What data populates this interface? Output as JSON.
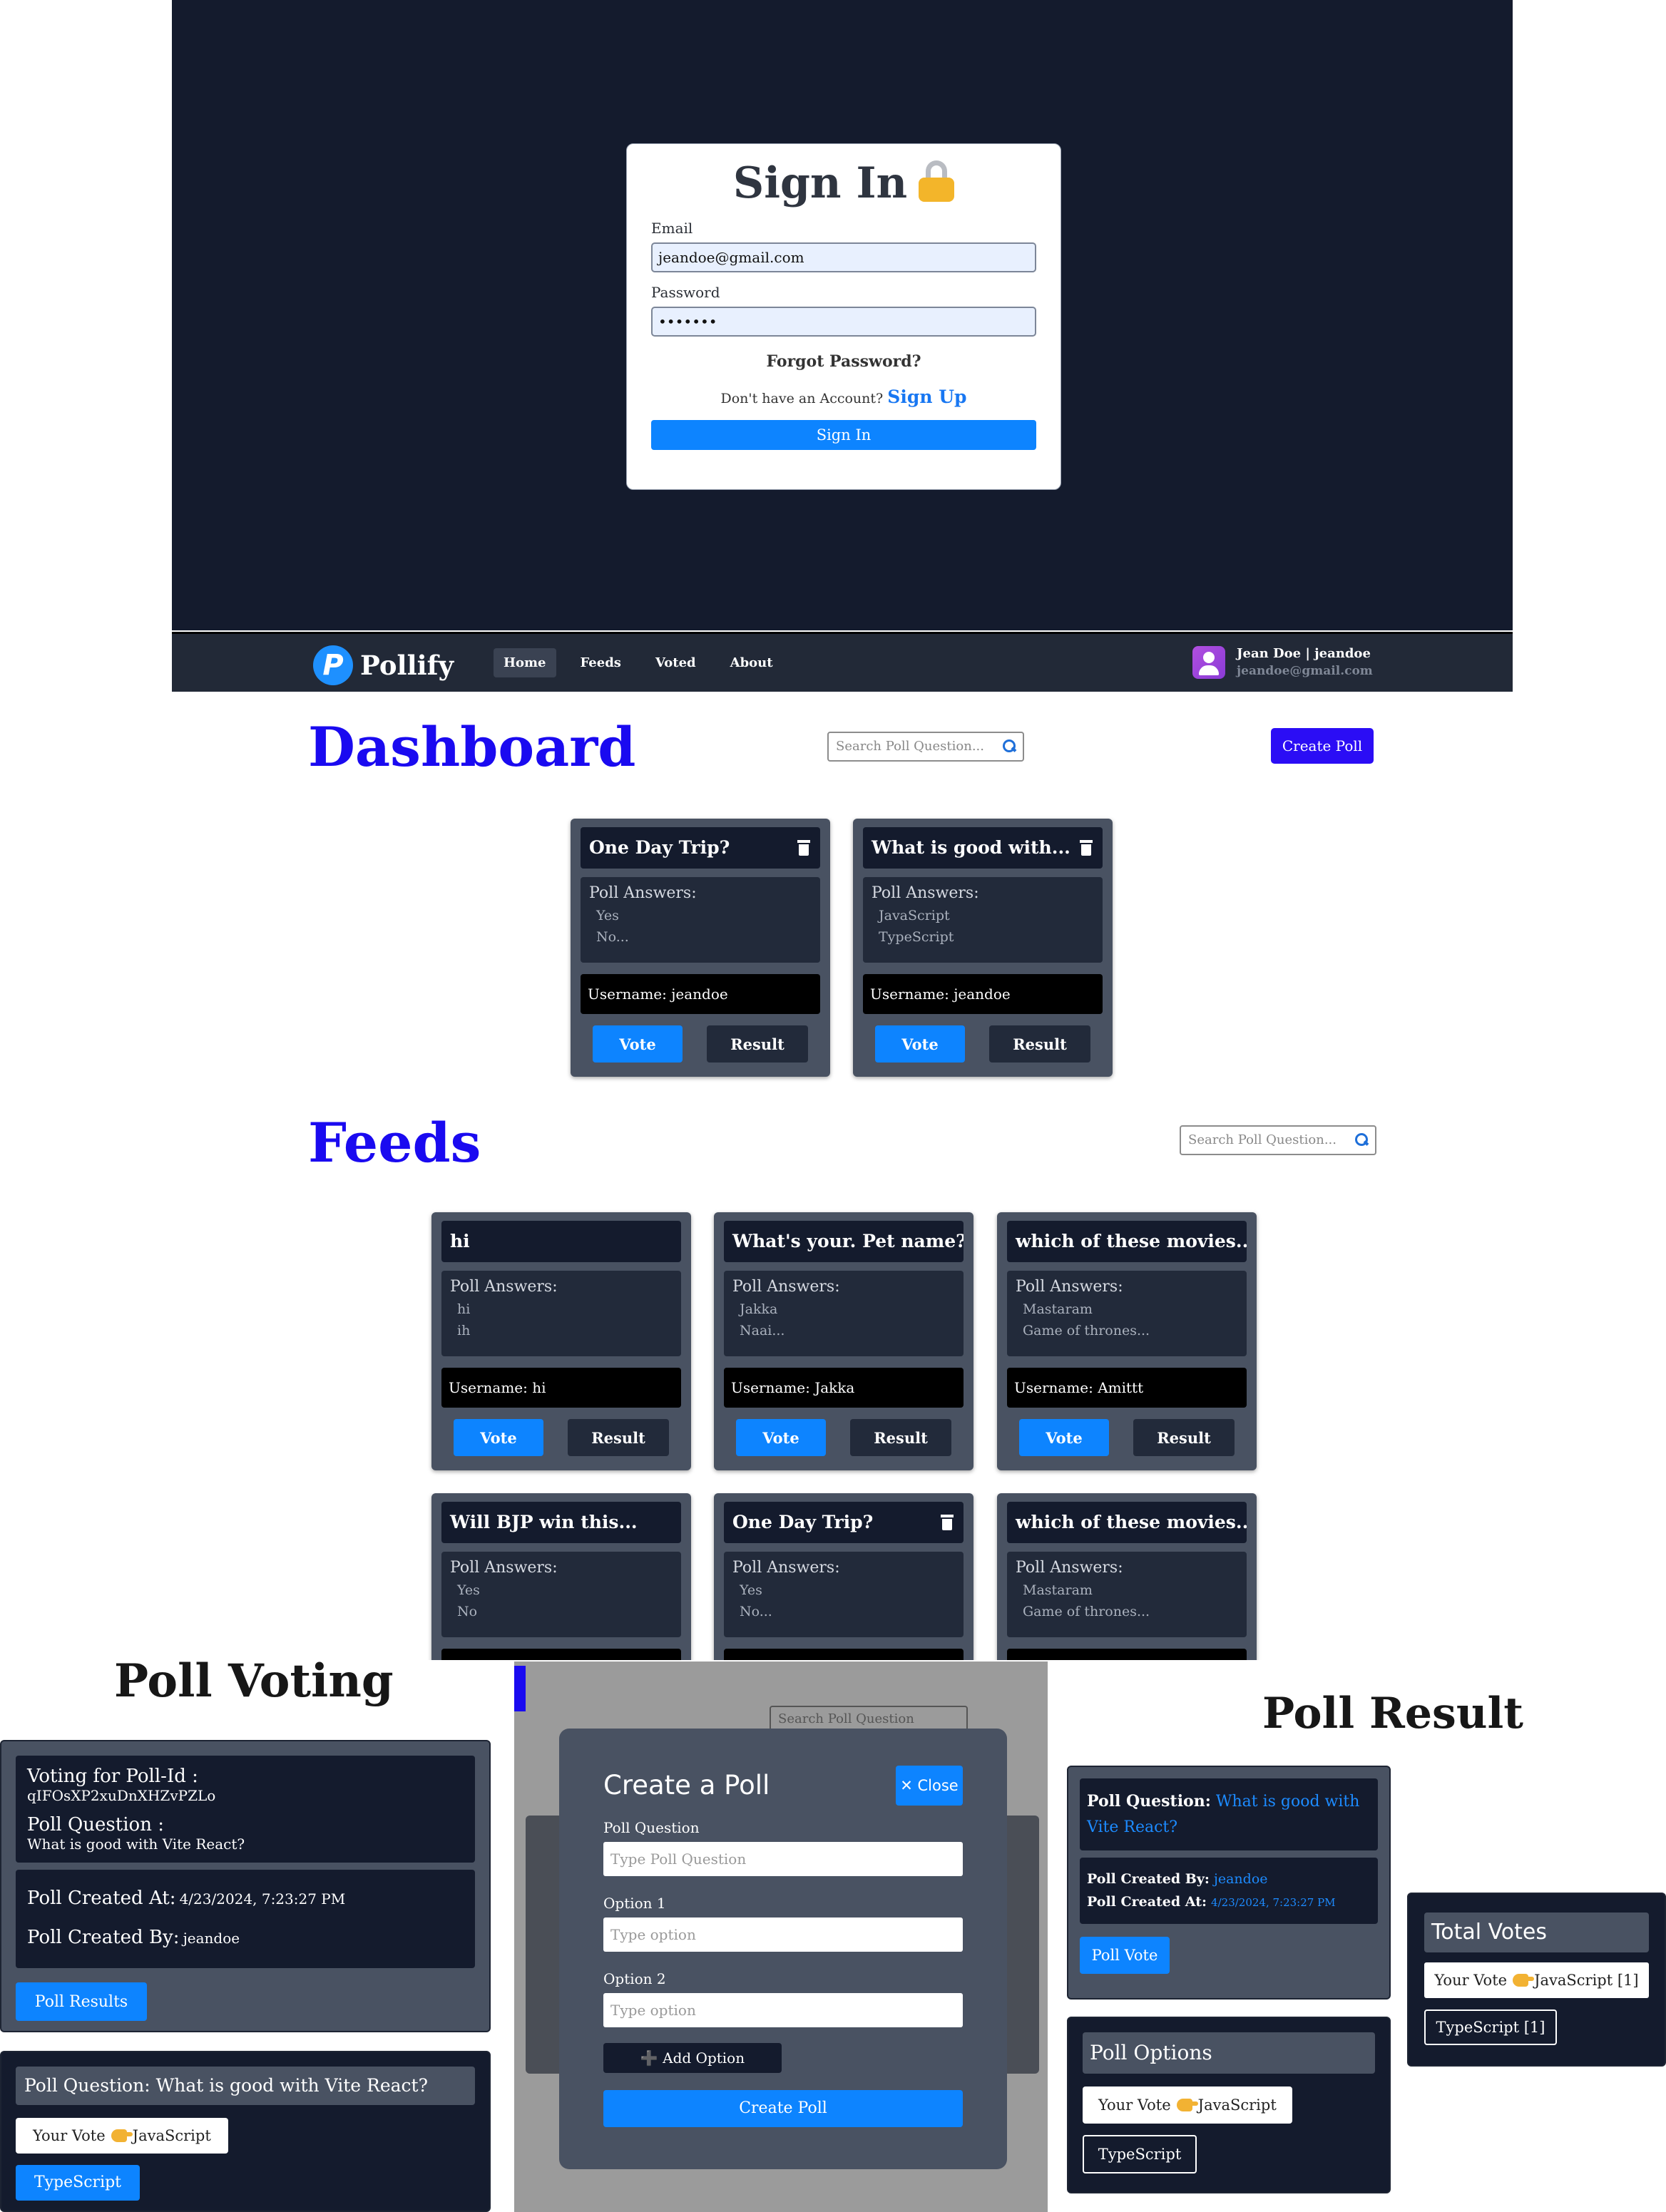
{
  "signin": {
    "title": "Sign In",
    "email_label": "Email",
    "email_value": "jeandoe@gmail.com",
    "password_label": "Password",
    "password_value": "•••••••",
    "forgot": "Forgot Password?",
    "no_account": "Don't have an Account?",
    "signup_link": "Sign Up",
    "button": "Sign In"
  },
  "navbar": {
    "logo_letter": "P",
    "brand": "Pollify",
    "links": [
      "Home",
      "Feeds",
      "Voted",
      "About"
    ],
    "user_name": "Jean Doe | jeandoe",
    "user_email": "jeandoe@gmail.com"
  },
  "dashboard": {
    "title": "Dashboard",
    "search_placeholder": "Search Poll Question...",
    "create_button": "Create Poll",
    "cards": [
      {
        "question": "One Day Trip?",
        "answers_title": "Poll Answers:",
        "answers": [
          "Yes",
          "No..."
        ],
        "username": "Username: jeandoe",
        "vote": "Vote",
        "result": "Result"
      },
      {
        "question": "What is good with...",
        "answers_title": "Poll Answers:",
        "answers": [
          "JavaScript",
          "TypeScript"
        ],
        "username": "Username: jeandoe",
        "vote": "Vote",
        "result": "Result"
      }
    ]
  },
  "feeds": {
    "title": "Feeds",
    "search_placeholder": "Search Poll Question...",
    "cards": [
      {
        "question": "hi",
        "answers_title": "Poll Answers:",
        "answers": [
          "hi",
          "ih"
        ],
        "username": "Username: hi",
        "vote": "Vote",
        "result": "Result"
      },
      {
        "question": "What's your. Pet name?",
        "answers_title": "Poll Answers:",
        "answers": [
          "Jakka",
          "Naai..."
        ],
        "username": "Username: Jakka",
        "vote": "Vote",
        "result": "Result"
      },
      {
        "question": "which of these movies...",
        "answers_title": "Poll Answers:",
        "answers": [
          "Mastaram",
          "Game of thrones..."
        ],
        "username": "Username: Amittt",
        "vote": "Vote",
        "result": "Result"
      },
      {
        "question": "Will BJP win this...",
        "answers_title": "Poll Answers:",
        "answers": [
          "Yes",
          "No"
        ]
      },
      {
        "question": "One Day Trip?",
        "answers_title": "Poll Answers:",
        "answers": [
          "Yes",
          "No..."
        ]
      },
      {
        "question": "which of these movies...",
        "answers_title": "Poll Answers:",
        "answers": [
          "Mastaram",
          "Game of thrones..."
        ]
      }
    ]
  },
  "voting": {
    "title": "Poll Voting",
    "poll_id_label": "Voting for Poll-Id :",
    "poll_id": "qIFOsXP2xuDnXHZvPZLo",
    "question_label": "Poll Question :",
    "question": "What is good with Vite React?",
    "created_at_label": "Poll Created At:",
    "created_at": "4/23/2024, 7:23:27 PM",
    "created_by_label": "Poll Created By:",
    "created_by": "jeandoe",
    "results_button": "Poll Results",
    "strip": "Poll Question: What is good with Vite React?",
    "your_vote": "Your Vote",
    "your_vote_option": "JavaScript",
    "other_option": "TypeScript"
  },
  "modal": {
    "title": "Create a Poll",
    "close": "✕ Close",
    "question_label": "Poll Question",
    "question_placeholder": "Type Poll Question",
    "option1_label": "Option 1",
    "option2_label": "Option 2",
    "option_placeholder": "Type option",
    "add_option": "➕ Add Option",
    "create_button": "Create Poll",
    "bg_search": "Search Poll Question"
  },
  "result": {
    "title": "Poll Result",
    "question_label": "Poll Question:",
    "question": "What is good with Vite React?",
    "created_by_label": "Poll Created By:",
    "created_by": "jeandoe",
    "created_at_label": "Poll Created At:",
    "created_at": "4/23/2024, 7:23:27 PM",
    "vote_button": "Poll Vote",
    "options_title": "Poll Options",
    "your_vote": "Your Vote",
    "your_vote_option": "JavaScript",
    "other_option": "TypeScript",
    "total_votes_title": "Total Votes",
    "vote_count_js": "JavaScript [1]",
    "vote_count_ts": "TypeScript [1]"
  }
}
